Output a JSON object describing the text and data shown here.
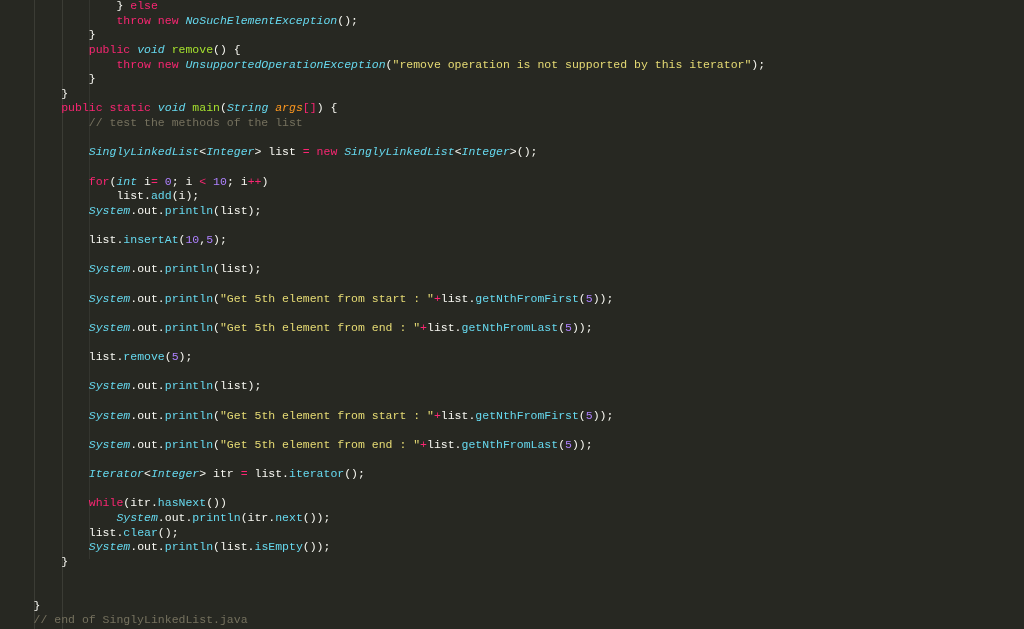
{
  "editor": {
    "lines": [
      {
        "kind": "code",
        "tokens": [
          {
            "text": "                } ",
            "kind": "p"
          },
          {
            "text": "else",
            "kind": "k"
          }
        ]
      },
      {
        "kind": "code",
        "tokens": [
          {
            "text": "                throw",
            "kind": "k"
          },
          {
            "text": " new",
            "kind": "k"
          },
          {
            "text": " NoSuchElementException",
            "kind": "t"
          },
          {
            "text": "();",
            "kind": "p"
          }
        ]
      },
      {
        "kind": "code",
        "tokens": [
          {
            "text": "            }",
            "kind": "p"
          }
        ]
      },
      {
        "kind": "code",
        "tokens": [
          {
            "text": "            public",
            "kind": "k"
          },
          {
            "text": " void",
            "kind": "t"
          },
          {
            "text": " remove",
            "kind": "f"
          },
          {
            "text": "() {",
            "kind": "p"
          }
        ]
      },
      {
        "kind": "code",
        "tokens": [
          {
            "text": "                throw",
            "kind": "k"
          },
          {
            "text": " new",
            "kind": "k"
          },
          {
            "text": " UnsupportedOperationException",
            "kind": "t"
          },
          {
            "text": "(",
            "kind": "p"
          },
          {
            "text": "\"remove operation is not supported by this iterator\"",
            "kind": "s"
          },
          {
            "text": ");",
            "kind": "p"
          }
        ]
      },
      {
        "kind": "code",
        "tokens": [
          {
            "text": "            }",
            "kind": "p"
          }
        ]
      },
      {
        "kind": "code",
        "tokens": [
          {
            "text": "        }",
            "kind": "p"
          }
        ]
      },
      {
        "kind": "code",
        "tokens": [
          {
            "text": "        public",
            "kind": "k"
          },
          {
            "text": " static",
            "kind": "k"
          },
          {
            "text": " void",
            "kind": "t"
          },
          {
            "text": " main",
            "kind": "f"
          },
          {
            "text": "(",
            "kind": "p"
          },
          {
            "text": "String",
            "kind": "t"
          },
          {
            "text": " args",
            "kind": "a"
          },
          {
            "text": "[]",
            "kind": "k"
          },
          {
            "text": ") {",
            "kind": "p"
          }
        ]
      },
      {
        "kind": "code",
        "tokens": [
          {
            "text": "            // test the methods of the list",
            "kind": "c"
          }
        ]
      },
      {
        "kind": "blank"
      },
      {
        "kind": "code",
        "tokens": [
          {
            "text": "            SinglyLinkedList",
            "kind": "t"
          },
          {
            "text": "<",
            "kind": "p"
          },
          {
            "text": "Integer",
            "kind": "t"
          },
          {
            "text": "> list",
            "kind": "p"
          },
          {
            "text": " =",
            "kind": "k"
          },
          {
            "text": " new",
            "kind": "k"
          },
          {
            "text": " SinglyLinkedList",
            "kind": "t"
          },
          {
            "text": "<",
            "kind": "p"
          },
          {
            "text": "Integer",
            "kind": "t"
          },
          {
            "text": ">();",
            "kind": "p"
          }
        ]
      },
      {
        "kind": "blank"
      },
      {
        "kind": "code",
        "tokens": [
          {
            "text": "            for",
            "kind": "k"
          },
          {
            "text": "(",
            "kind": "p"
          },
          {
            "text": "int",
            "kind": "t"
          },
          {
            "text": " i",
            "kind": "p"
          },
          {
            "text": "=",
            "kind": "k"
          },
          {
            "text": " 0",
            "kind": "n"
          },
          {
            "text": "; i",
            "kind": "p"
          },
          {
            "text": " <",
            "kind": "k"
          },
          {
            "text": " 10",
            "kind": "n"
          },
          {
            "text": "; i",
            "kind": "p"
          },
          {
            "text": "++",
            "kind": "k"
          },
          {
            "text": ")",
            "kind": "p"
          }
        ]
      },
      {
        "kind": "code",
        "tokens": [
          {
            "text": "                list.",
            "kind": "p"
          },
          {
            "text": "add",
            "kind": "m"
          },
          {
            "text": "(i);",
            "kind": "p"
          }
        ]
      },
      {
        "kind": "code",
        "tokens": [
          {
            "text": "            System",
            "kind": "t"
          },
          {
            "text": ".out.",
            "kind": "p"
          },
          {
            "text": "println",
            "kind": "m"
          },
          {
            "text": "(list);",
            "kind": "p"
          }
        ]
      },
      {
        "kind": "blank"
      },
      {
        "kind": "code",
        "tokens": [
          {
            "text": "            list.",
            "kind": "p"
          },
          {
            "text": "insertAt",
            "kind": "m"
          },
          {
            "text": "(",
            "kind": "p"
          },
          {
            "text": "10",
            "kind": "n"
          },
          {
            "text": ",",
            "kind": "p"
          },
          {
            "text": "5",
            "kind": "n"
          },
          {
            "text": ");",
            "kind": "p"
          }
        ]
      },
      {
        "kind": "blank"
      },
      {
        "kind": "code",
        "tokens": [
          {
            "text": "            System",
            "kind": "t"
          },
          {
            "text": ".out.",
            "kind": "p"
          },
          {
            "text": "println",
            "kind": "m"
          },
          {
            "text": "(list);",
            "kind": "p"
          }
        ]
      },
      {
        "kind": "blank"
      },
      {
        "kind": "code",
        "tokens": [
          {
            "text": "            System",
            "kind": "t"
          },
          {
            "text": ".out.",
            "kind": "p"
          },
          {
            "text": "println",
            "kind": "m"
          },
          {
            "text": "(",
            "kind": "p"
          },
          {
            "text": "\"Get 5th element from start : \"",
            "kind": "s"
          },
          {
            "text": "+",
            "kind": "k"
          },
          {
            "text": "list.",
            "kind": "p"
          },
          {
            "text": "getNthFromFirst",
            "kind": "m"
          },
          {
            "text": "(",
            "kind": "p"
          },
          {
            "text": "5",
            "kind": "n"
          },
          {
            "text": "));",
            "kind": "p"
          }
        ]
      },
      {
        "kind": "blank"
      },
      {
        "kind": "code",
        "tokens": [
          {
            "text": "            System",
            "kind": "t"
          },
          {
            "text": ".out.",
            "kind": "p"
          },
          {
            "text": "println",
            "kind": "m"
          },
          {
            "text": "(",
            "kind": "p"
          },
          {
            "text": "\"Get 5th element from end : \"",
            "kind": "s"
          },
          {
            "text": "+",
            "kind": "k"
          },
          {
            "text": "list.",
            "kind": "p"
          },
          {
            "text": "getNthFromLast",
            "kind": "m"
          },
          {
            "text": "(",
            "kind": "p"
          },
          {
            "text": "5",
            "kind": "n"
          },
          {
            "text": "));",
            "kind": "p"
          }
        ]
      },
      {
        "kind": "blank"
      },
      {
        "kind": "code",
        "tokens": [
          {
            "text": "            list.",
            "kind": "p"
          },
          {
            "text": "remove",
            "kind": "m"
          },
          {
            "text": "(",
            "kind": "p"
          },
          {
            "text": "5",
            "kind": "n"
          },
          {
            "text": ");",
            "kind": "p"
          }
        ]
      },
      {
        "kind": "blank"
      },
      {
        "kind": "code",
        "tokens": [
          {
            "text": "            System",
            "kind": "t"
          },
          {
            "text": ".out.",
            "kind": "p"
          },
          {
            "text": "println",
            "kind": "m"
          },
          {
            "text": "(list);",
            "kind": "p"
          }
        ]
      },
      {
        "kind": "blank"
      },
      {
        "kind": "code",
        "tokens": [
          {
            "text": "            System",
            "kind": "t"
          },
          {
            "text": ".out.",
            "kind": "p"
          },
          {
            "text": "println",
            "kind": "m"
          },
          {
            "text": "(",
            "kind": "p"
          },
          {
            "text": "\"Get 5th element from start : \"",
            "kind": "s"
          },
          {
            "text": "+",
            "kind": "k"
          },
          {
            "text": "list.",
            "kind": "p"
          },
          {
            "text": "getNthFromFirst",
            "kind": "m"
          },
          {
            "text": "(",
            "kind": "p"
          },
          {
            "text": "5",
            "kind": "n"
          },
          {
            "text": "));",
            "kind": "p"
          }
        ]
      },
      {
        "kind": "blank"
      },
      {
        "kind": "code",
        "tokens": [
          {
            "text": "            System",
            "kind": "t"
          },
          {
            "text": ".out.",
            "kind": "p"
          },
          {
            "text": "println",
            "kind": "m"
          },
          {
            "text": "(",
            "kind": "p"
          },
          {
            "text": "\"Get 5th element from end : \"",
            "kind": "s"
          },
          {
            "text": "+",
            "kind": "k"
          },
          {
            "text": "list.",
            "kind": "p"
          },
          {
            "text": "getNthFromLast",
            "kind": "m"
          },
          {
            "text": "(",
            "kind": "p"
          },
          {
            "text": "5",
            "kind": "n"
          },
          {
            "text": "));",
            "kind": "p"
          }
        ]
      },
      {
        "kind": "blank"
      },
      {
        "kind": "code",
        "tokens": [
          {
            "text": "            Iterator",
            "kind": "t"
          },
          {
            "text": "<",
            "kind": "p"
          },
          {
            "text": "Integer",
            "kind": "t"
          },
          {
            "text": "> itr",
            "kind": "p"
          },
          {
            "text": " =",
            "kind": "k"
          },
          {
            "text": " list.",
            "kind": "p"
          },
          {
            "text": "iterator",
            "kind": "m"
          },
          {
            "text": "();",
            "kind": "p"
          }
        ]
      },
      {
        "kind": "blank"
      },
      {
        "kind": "code",
        "tokens": [
          {
            "text": "            while",
            "kind": "k"
          },
          {
            "text": "(itr.",
            "kind": "p"
          },
          {
            "text": "hasNext",
            "kind": "m"
          },
          {
            "text": "())",
            "kind": "p"
          }
        ]
      },
      {
        "kind": "code",
        "tokens": [
          {
            "text": "                System",
            "kind": "t"
          },
          {
            "text": ".out.",
            "kind": "p"
          },
          {
            "text": "println",
            "kind": "m"
          },
          {
            "text": "(itr.",
            "kind": "p"
          },
          {
            "text": "next",
            "kind": "m"
          },
          {
            "text": "());",
            "kind": "p"
          }
        ]
      },
      {
        "kind": "code",
        "tokens": [
          {
            "text": "            list.",
            "kind": "p"
          },
          {
            "text": "clear",
            "kind": "m"
          },
          {
            "text": "();",
            "kind": "p"
          }
        ]
      },
      {
        "kind": "code",
        "tokens": [
          {
            "text": "            System",
            "kind": "t"
          },
          {
            "text": ".out.",
            "kind": "p"
          },
          {
            "text": "println",
            "kind": "m"
          },
          {
            "text": "(list.",
            "kind": "p"
          },
          {
            "text": "isEmpty",
            "kind": "m"
          },
          {
            "text": "());",
            "kind": "p"
          }
        ]
      },
      {
        "kind": "code",
        "tokens": [
          {
            "text": "        }",
            "kind": "p"
          }
        ]
      },
      {
        "kind": "blank"
      },
      {
        "kind": "blank"
      },
      {
        "kind": "code",
        "tokens": [
          {
            "text": "    }",
            "kind": "p"
          }
        ]
      },
      {
        "kind": "code",
        "tokens": [
          {
            "text": "    // end of SinglyLinkedList.java",
            "kind": "c"
          }
        ]
      }
    ]
  }
}
